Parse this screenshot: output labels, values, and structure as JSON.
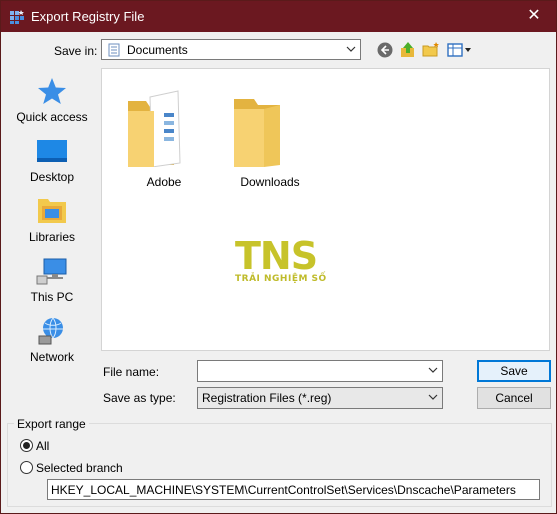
{
  "window": {
    "title": "Export Registry File",
    "close_glyph": "✕"
  },
  "savein": {
    "label": "Save in:",
    "value": "Documents"
  },
  "toolbar": {
    "back_icon": "back-arrow-icon",
    "up_icon": "up-folder-icon",
    "newfolder_icon": "new-folder-icon",
    "view_icon": "view-menu-icon"
  },
  "places": [
    {
      "label": "Quick access",
      "icon": "star-icon"
    },
    {
      "label": "Desktop",
      "icon": "desktop-icon"
    },
    {
      "label": "Libraries",
      "icon": "libraries-icon"
    },
    {
      "label": "This PC",
      "icon": "computer-icon"
    },
    {
      "label": "Network",
      "icon": "network-icon"
    }
  ],
  "files": [
    {
      "name": "Adobe",
      "icon": "folder-with-documents-icon"
    },
    {
      "name": "Downloads",
      "icon": "folder-icon"
    }
  ],
  "watermark": {
    "main": "TNS",
    "sub": "TRẢI NGHIỆM SỐ"
  },
  "filename": {
    "label": "File name:",
    "value": ""
  },
  "savetype": {
    "label": "Save as type:",
    "value": "Registration Files (*.reg)"
  },
  "buttons": {
    "save": "Save",
    "cancel": "Cancel"
  },
  "export_range": {
    "title": "Export range",
    "all_label": "All",
    "selected_label": "Selected branch",
    "all_checked": true,
    "branch_path": "HKEY_LOCAL_MACHINE\\SYSTEM\\CurrentControlSet\\Services\\Dnscache\\Parameters"
  },
  "colors": {
    "titlebar": "#6b1820",
    "accent": "#0078d7",
    "folder": "#f2c94c"
  }
}
